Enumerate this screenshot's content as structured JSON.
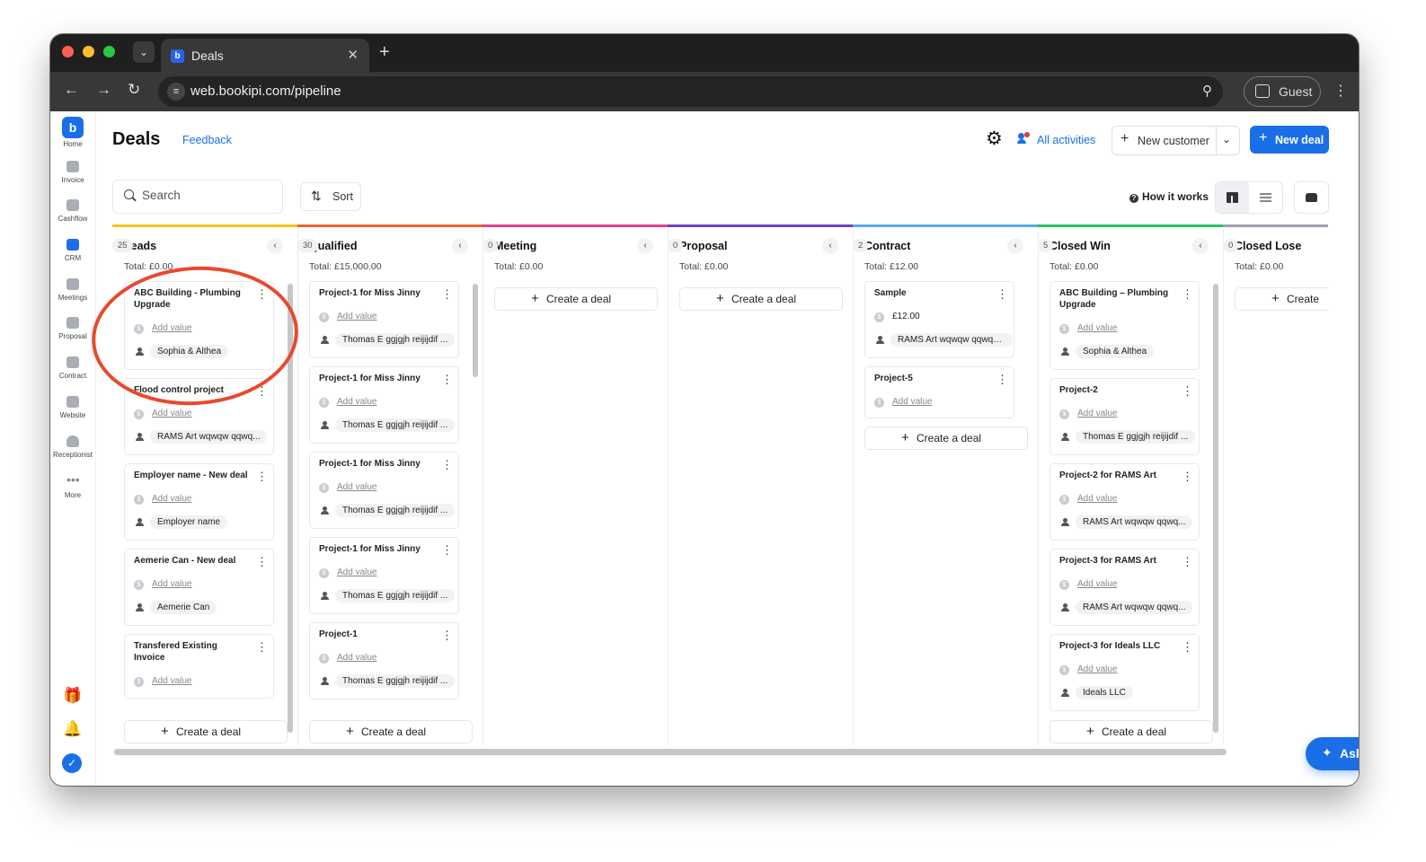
{
  "browser": {
    "tab_title": "Deals",
    "url": "web.bookipi.com/pipeline",
    "profile_label": "Guest",
    "traffic_lights": [
      "#ff5f57",
      "#febc2e",
      "#28c840"
    ]
  },
  "sidebar": {
    "items": [
      {
        "label": "Home",
        "icon": "home-logo-icon"
      },
      {
        "label": "Invoice",
        "icon": "invoice-icon"
      },
      {
        "label": "Cashflow",
        "icon": "cashflow-icon"
      },
      {
        "label": "CRM",
        "icon": "crm-chart-icon"
      },
      {
        "label": "Meetings",
        "icon": "meetings-icon"
      },
      {
        "label": "Proposal",
        "icon": "proposal-icon"
      },
      {
        "label": "Contract",
        "icon": "contract-icon"
      },
      {
        "label": "Website",
        "icon": "website-icon"
      },
      {
        "label": "Receptionist",
        "icon": "headset-icon"
      },
      {
        "label": "More",
        "icon": "more-dots-icon"
      }
    ],
    "bottom_icons": [
      "gift-icon",
      "bell-icon",
      "bookipi-check-icon"
    ]
  },
  "header": {
    "title": "Deals",
    "feedback_label": "Feedback",
    "activities_label": "All activities",
    "new_customer_label": "New customer",
    "new_deal_label": "New deal"
  },
  "toolbar": {
    "search_placeholder": "Search",
    "sort_label": "Sort",
    "how_label": "How it works"
  },
  "create_label": "Create a deal",
  "create_label_short": "Create",
  "columns": [
    {
      "name": "Leads",
      "count": "25",
      "total": "Total: £0.00",
      "color": "#f5c518",
      "cards": [
        {
          "title": "ABC Building - Plumbing Upgrade",
          "value": "Add value",
          "person": "Sophia & Althea"
        },
        {
          "title": "Flood control project",
          "value": "Add value",
          "person": "RAMS Art wqwqw qqwq..."
        },
        {
          "title": "Employer name - New deal",
          "value": "Add value",
          "person": "Employer name"
        },
        {
          "title": "Aemerie Can - New deal",
          "value": "Add value",
          "person": "Aemerie Can"
        },
        {
          "title": "Transfered Existing Invoice",
          "value": "Add value",
          "person": ""
        }
      ]
    },
    {
      "name": "Qualified",
      "count": "30",
      "total": "Total: £15,000.00",
      "color": "#f0622b",
      "cards": [
        {
          "title": "Project-1 for Miss Jinny",
          "value": "Add value",
          "person": "Thomas E ggjgjh reijijdif ..."
        },
        {
          "title": "Project-1 for Miss Jinny",
          "value": "Add value",
          "person": "Thomas E ggjgjh reijijdif ..."
        },
        {
          "title": "Project-1 for Miss Jinny",
          "value": "Add value",
          "person": "Thomas E ggjgjh reijijdif ..."
        },
        {
          "title": "Project-1 for Miss Jinny",
          "value": "Add value",
          "person": "Thomas E ggjgjh reijijdif ..."
        },
        {
          "title": "Project-1",
          "value": "Add value",
          "person": "Thomas E ggjgjh reijijdif ..."
        }
      ]
    },
    {
      "name": "Meeting",
      "count": "0",
      "total": "Total: £0.00",
      "color": "#e83e8c",
      "cards": []
    },
    {
      "name": "Proposal",
      "count": "0",
      "total": "Total: £0.00",
      "color": "#6f42c1",
      "cards": []
    },
    {
      "name": "Contract",
      "count": "2",
      "total": "Total: £12.00",
      "color": "#5aa9e6",
      "cards": [
        {
          "title": "Sample",
          "value": "£12.00",
          "person": "RAMS Art wqwqw qqwqwq ..."
        },
        {
          "title": "Project-5",
          "value": "Add value",
          "person": ""
        }
      ]
    },
    {
      "name": "Closed Win",
      "count": "5",
      "total": "Total: £0.00",
      "color": "#22c55e",
      "cards": [
        {
          "title": "ABC Building – Plumbing Upgrade",
          "value": "Add value",
          "person": "Sophia & Althea"
        },
        {
          "title": "Project-2",
          "value": "Add value",
          "person": "Thomas E ggjgjh reijijdif ..."
        },
        {
          "title": "Project-2 for RAMS Art",
          "value": "Add value",
          "person": "RAMS Art wqwqw qqwq..."
        },
        {
          "title": "Project-3 for RAMS Art",
          "value": "Add value",
          "person": "RAMS Art wqwqw qqwq..."
        },
        {
          "title": "Project-3 for Ideals LLC",
          "value": "Add value",
          "person": "Ideals LLC"
        }
      ]
    },
    {
      "name": "Closed Lose",
      "count": "0",
      "total": "Total: £0.00",
      "color": "#9ca3af",
      "cards": []
    }
  ],
  "ask_ai_label": "Ask AI",
  "annotation_color": "#e8492e"
}
